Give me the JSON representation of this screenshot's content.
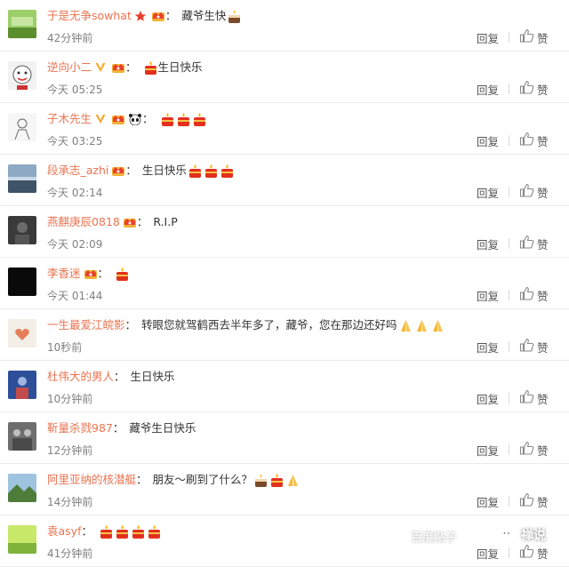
{
  "comments": [
    {
      "user": "于是无争sowhat",
      "badges": [
        "star",
        "crown"
      ],
      "text": "藏爷生快",
      "emojis": [
        "cake"
      ],
      "time": "42分钟前",
      "avatar": "green-field"
    },
    {
      "user": "逆向小二",
      "badges": [
        "v",
        "crown"
      ],
      "text": "生日快乐",
      "emojis": [
        "candle"
      ],
      "emoji_first": true,
      "time": "今天 05:25",
      "avatar": "cartoon-face"
    },
    {
      "user": "子木先生",
      "badges": [
        "v",
        "crown",
        "panda"
      ],
      "text": "",
      "emojis": [
        "candle",
        "candle",
        "candle"
      ],
      "time": "今天 03:25",
      "avatar": "sketch"
    },
    {
      "user": "段承志_azhi",
      "badges": [
        "crown"
      ],
      "text": "生日快乐",
      "emojis": [
        "candle",
        "candle",
        "candle"
      ],
      "time": "今天 02:14",
      "avatar": "sky"
    },
    {
      "user": "燕麒庚辰0818",
      "badges": [
        "crown"
      ],
      "text": "R.I.P",
      "emojis": [],
      "time": "今天 02:09",
      "avatar": "dark-person"
    },
    {
      "user": "李香迷",
      "badges": [
        "crown"
      ],
      "text": "",
      "emojis": [
        "candle"
      ],
      "time": "今天 01:44",
      "avatar": "black"
    },
    {
      "user": "一生最爱江皖影",
      "badges": [],
      "text": "转眼您就驾鹤西去半年多了，藏爷，您在那边还好吗",
      "emojis": [
        "pray",
        "pray",
        "pray"
      ],
      "time": "10秒前",
      "avatar": "heart-card"
    },
    {
      "user": "杜伟大的男人",
      "badges": [],
      "text": "生日快乐",
      "emojis": [],
      "time": "10分钟前",
      "avatar": "blue-figure"
    },
    {
      "user": "靳量杀戮987",
      "badges": [],
      "text": "藏爷生日快乐",
      "emojis": [],
      "time": "12分钟前",
      "avatar": "people"
    },
    {
      "user": "阿里亚纳的核潜艇",
      "badges": [],
      "text": "朋友～刷到了什么？",
      "emojis": [
        "cake",
        "candle",
        "pray"
      ],
      "time": "14分钟前",
      "avatar": "landscape"
    },
    {
      "user": "袁asyf",
      "badges": [],
      "text": "",
      "emojis": [
        "candle",
        "candle",
        "candle",
        "candle"
      ],
      "time": "41分钟前",
      "avatar": "bright-green"
    }
  ],
  "actions": {
    "reply_label": "回复",
    "like_label": "赞"
  },
  "watermark": {
    "left_text": "百度贴子",
    "brand_text": "禅说"
  },
  "colors": {
    "username": "#eb7350",
    "time": "#808080",
    "text": "#333333"
  }
}
